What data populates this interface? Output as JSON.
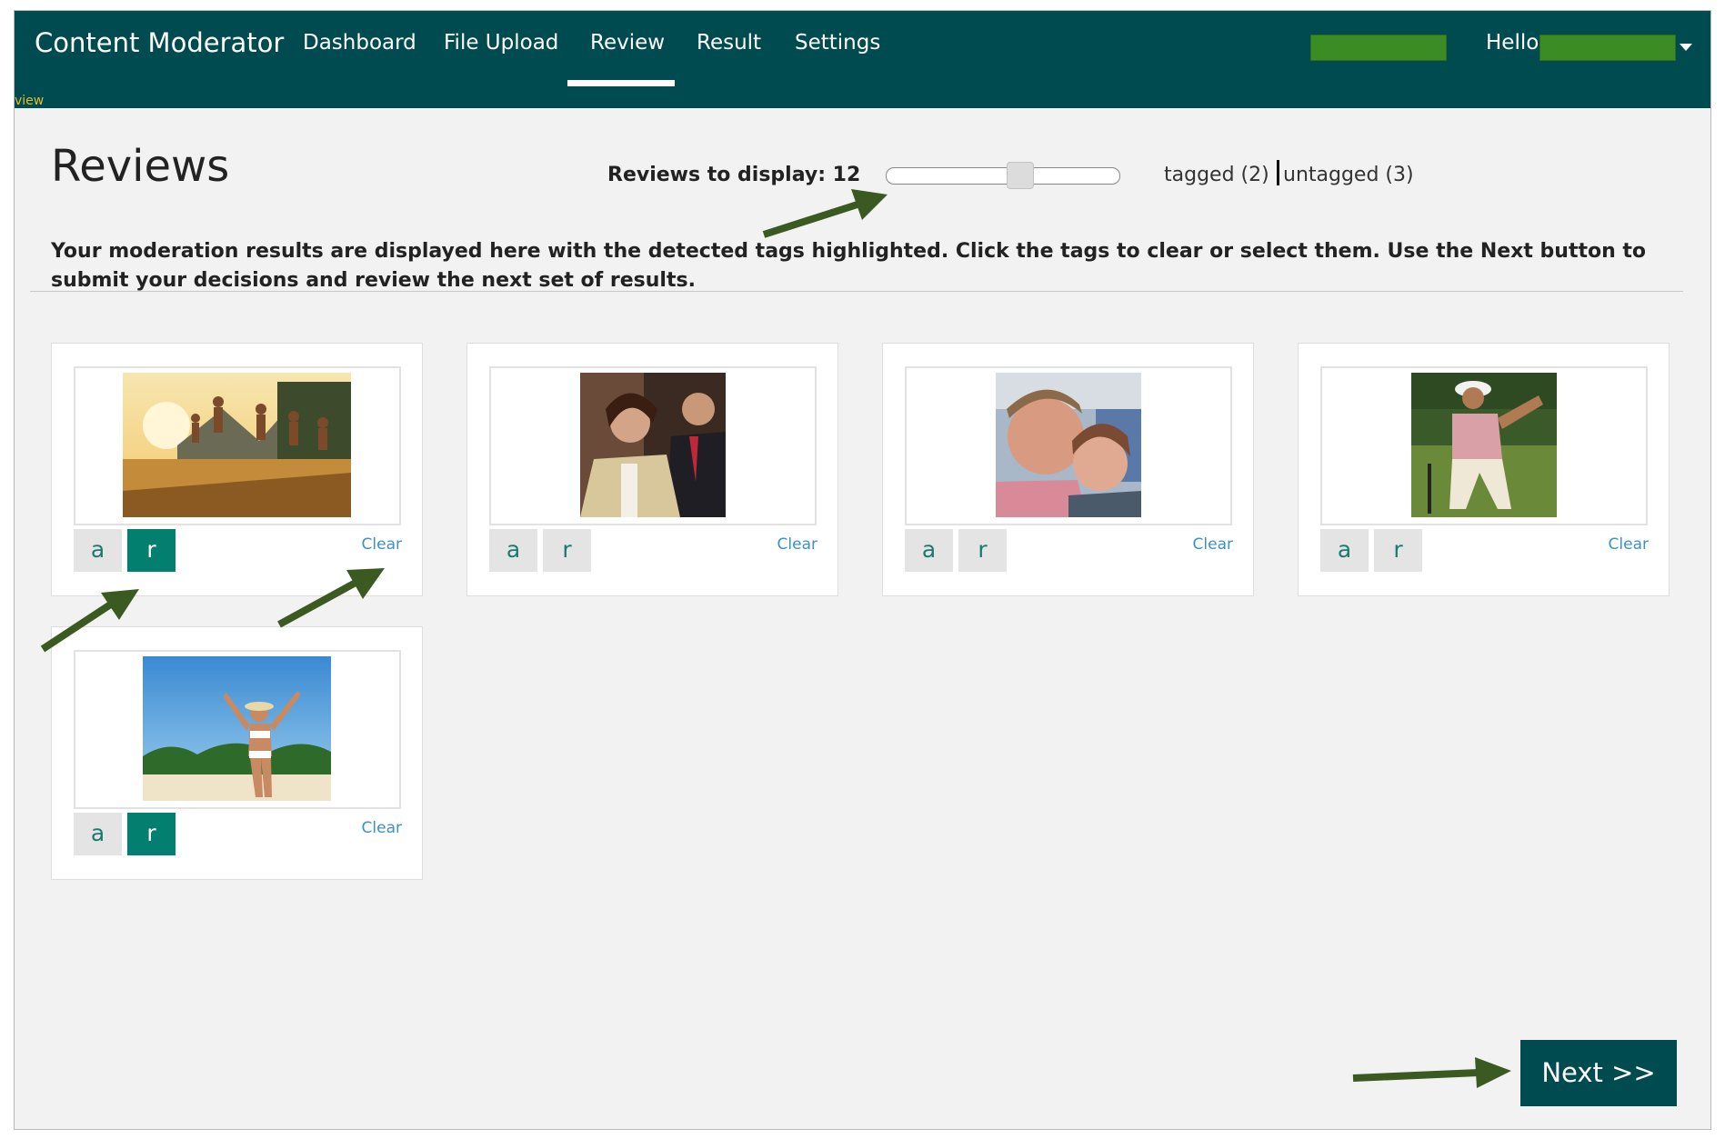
{
  "header": {
    "brand": "Content Moderator",
    "nav": [
      "Dashboard",
      "File Upload",
      "Review",
      "Result",
      "Settings"
    ],
    "active_nav": "Review",
    "greeting": "Hello",
    "view_link": "view"
  },
  "page": {
    "title": "Reviews",
    "reviews_to_display_label": "Reviews to display: 12",
    "slider_level": 0.59,
    "filter_tagged": "tagged (2)",
    "filter_untagged": "untagged (3)",
    "instructions": "Your moderation results are displayed here with the detected tags highlighted. Click the tags to clear or select them. Use the Next button to submit your decisions and review the next set of results."
  },
  "cards": [
    {
      "photo": "people jumping into lake",
      "tag_a": "a",
      "tag_r": "r",
      "r_selected": true,
      "clear": "Clear"
    },
    {
      "photo": "woman and man in suits",
      "tag_a": "a",
      "tag_r": "r",
      "r_selected": false,
      "clear": "Clear"
    },
    {
      "photo": "man and woman close-up",
      "tag_a": "a",
      "tag_r": "r",
      "r_selected": false,
      "clear": "Clear"
    },
    {
      "photo": "golfer walking on course",
      "tag_a": "a",
      "tag_r": "r",
      "r_selected": false,
      "clear": "Clear"
    },
    {
      "photo": "woman in bikini on beach",
      "tag_a": "a",
      "tag_r": "r",
      "r_selected": true,
      "clear": "Clear"
    }
  ],
  "footer": {
    "next_label": "Next >>"
  },
  "colors": {
    "header": "#004b50",
    "tag_selected": "#037f6f",
    "annotation_arrow": "#3a5a22",
    "link": "#3b92c8"
  }
}
